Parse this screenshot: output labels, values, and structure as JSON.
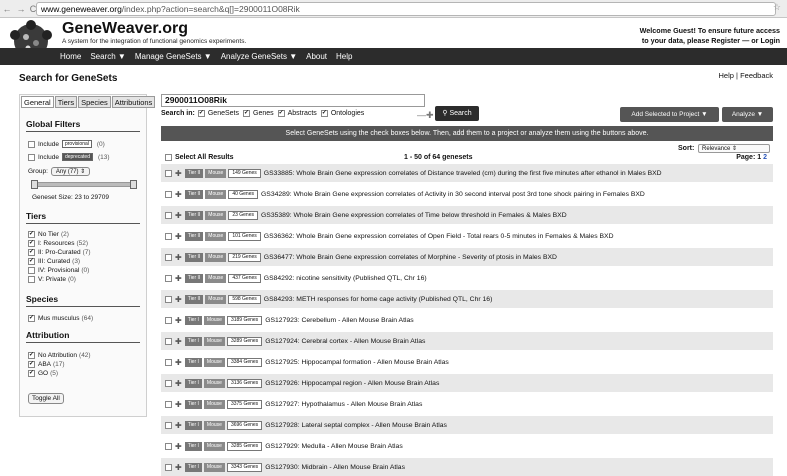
{
  "browser": {
    "url_domain": "www.geneweaver.org",
    "url_path": "/index.php?action=search&q[]=2900011O08Rik",
    "back": "←",
    "forward": "→",
    "reload": "C",
    "star": "☆"
  },
  "header": {
    "brand": "GeneWeaver.org",
    "tagline": "A system for the integration of functional genomics experiments.",
    "welcome_line1": "Welcome Guest! To ensure future access",
    "welcome_line2": "to your data, please Register — or Login"
  },
  "menu": [
    "Home",
    "Search ▼",
    "Manage GeneSets ▼",
    "Analyze GeneSets ▼",
    "About",
    "Help"
  ],
  "page": {
    "title": "Search for GeneSets",
    "help": "Help",
    "sep": "|",
    "feedback": "Feedback"
  },
  "sidebar": {
    "tabs": [
      "General",
      "Tiers",
      "Species",
      "Attributions"
    ],
    "global_filters": "Global Filters",
    "include": "Include",
    "provisional_tag": "provisional",
    "provisional_count": "(0)",
    "deprecated_tag": "deprecated",
    "deprecated_count": "(13)",
    "group_label": "Group:",
    "group_value": "Any (77) ⇕",
    "geneset_size": "Geneset Size: 23 to 29709",
    "tiers_title": "Tiers",
    "tiers": [
      {
        "label": "No Tier",
        "count": "(2)",
        "checked": true
      },
      {
        "label": "I: Resources",
        "count": "(52)",
        "checked": true
      },
      {
        "label": "II: Pro-Curated",
        "count": "(7)",
        "checked": true
      },
      {
        "label": "III: Curated",
        "count": "(3)",
        "checked": true
      },
      {
        "label": "IV: Provisional",
        "count": "(0)",
        "checked": false
      },
      {
        "label": "V: Private",
        "count": "(0)",
        "checked": false
      }
    ],
    "species_title": "Species",
    "species": [
      {
        "label": "Mus musculus",
        "count": "(64)",
        "checked": true
      }
    ],
    "attribution_title": "Attribution",
    "attributions": [
      {
        "label": "No Attribution",
        "count": "(42)",
        "checked": true
      },
      {
        "label": "ABA",
        "count": "(17)",
        "checked": true
      },
      {
        "label": "GO",
        "count": "(5)",
        "checked": true
      }
    ],
    "toggle_all": "Toggle All"
  },
  "search": {
    "query": "2900011O08Rik",
    "search_in": "Search in:",
    "options": [
      "GeneSets",
      "Genes",
      "Abstracts",
      "Ontologies"
    ],
    "button": "Search",
    "add_plus": "—✚"
  },
  "actions": {
    "add_to_project": "Add Selected to Project ▼",
    "analyze": "Analyze ▼"
  },
  "instructions": "Select GeneSets using the check boxes below. Then, add them to a project or analyze them using the buttons above.",
  "results": {
    "sort_label": "Sort:",
    "sort_value": "Relevance ⇕",
    "select_all": "Select All Results",
    "range": "1 - 50 of 64 genesets",
    "page_label": "Page:",
    "page_current": "1",
    "page_next": "2",
    "rows": [
      {
        "tier": "Tier II",
        "species": "Mouse",
        "genes": "149 Genes",
        "title": "GS33885: Whole Brain Gene expression correlates of Distance traveled (cm) during the first five minutes after ethanol in Males BXD"
      },
      {
        "tier": "Tier II",
        "species": "Mouse",
        "genes": "40 Genes",
        "title": "GS34289: Whole Brain Gene expression correlates of Activity in 30 second interval post 3rd tone shock pairing in Females BXD"
      },
      {
        "tier": "Tier II",
        "species": "Mouse",
        "genes": "23 Genes",
        "title": "GS35389: Whole Brain Gene expression correlates of Time below threshold in Females & Males BXD"
      },
      {
        "tier": "Tier II",
        "species": "Mouse",
        "genes": "101 Genes",
        "title": "GS36362: Whole Brain Gene expression correlates of Open Field - Total rears 0-5 minutes in Females & Males BXD"
      },
      {
        "tier": "Tier II",
        "species": "Mouse",
        "genes": "219 Genes",
        "title": "GS36477: Whole Brain Gene expression correlates of Morphine - Severity of ptosis in Males BXD"
      },
      {
        "tier": "Tier II",
        "species": "Mouse",
        "genes": "437 Genes",
        "title": "GS84292: nicotine sensitivity (Published QTL, Chr 16)"
      },
      {
        "tier": "Tier II",
        "species": "Mouse",
        "genes": "598 Genes",
        "title": "GS84293: METH responses for home cage activity (Published QTL, Chr 16)"
      },
      {
        "tier": "Tier I",
        "species": "Mouse",
        "genes": "3189 Genes",
        "title": "GS127923: Cerebellum - Allen Mouse Brain Atlas"
      },
      {
        "tier": "Tier I",
        "species": "Mouse",
        "genes": "3289 Genes",
        "title": "GS127924: Cerebral cortex - Allen Mouse Brain Atlas"
      },
      {
        "tier": "Tier I",
        "species": "Mouse",
        "genes": "3384 Genes",
        "title": "GS127925: Hippocampal formation - Allen Mouse Brain Atlas"
      },
      {
        "tier": "Tier I",
        "species": "Mouse",
        "genes": "3136 Genes",
        "title": "GS127926: Hippocampal region - Allen Mouse Brain Atlas"
      },
      {
        "tier": "Tier I",
        "species": "Mouse",
        "genes": "3375 Genes",
        "title": "GS127927: Hypothalamus - Allen Mouse Brain Atlas"
      },
      {
        "tier": "Tier I",
        "species": "Mouse",
        "genes": "3696 Genes",
        "title": "GS127928: Lateral septal complex - Allen Mouse Brain Atlas"
      },
      {
        "tier": "Tier I",
        "species": "Mouse",
        "genes": "3285 Genes",
        "title": "GS127929: Medulla - Allen Mouse Brain Atlas"
      },
      {
        "tier": "Tier I",
        "species": "Mouse",
        "genes": "3343 Genes",
        "title": "GS127930: Midbrain - Allen Mouse Brain Atlas"
      }
    ]
  }
}
